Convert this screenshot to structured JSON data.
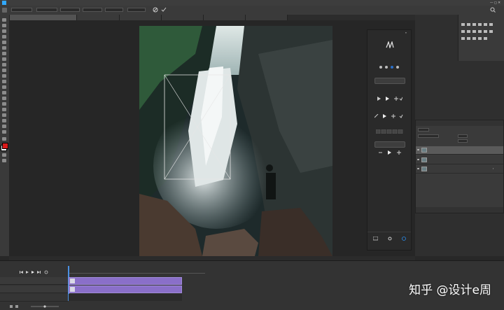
{
  "menubar": {
    "items": [
      "",
      "",
      "",
      "",
      "",
      "",
      "",
      "",
      "",
      "",
      "",
      ""
    ]
  },
  "tabs": [
    {
      "label": "",
      "active": true
    },
    {
      "label": ""
    },
    {
      "label": ""
    },
    {
      "label": ""
    },
    {
      "label": ""
    },
    {
      "label": ""
    }
  ],
  "right_top": {
    "tab1": "",
    "tab2": ""
  },
  "extension": {
    "panel_title": "",
    "logo_text": "",
    "sub_text": "",
    "btn_primary": "",
    "section1": "",
    "section2": "",
    "section3": "",
    "btn_middle": "",
    "info_title": "",
    "info_lines": [
      "",
      "",
      ""
    ],
    "info_link1": "",
    "info_link2": "",
    "bottom_tabs": [
      "",
      "",
      ""
    ]
  },
  "layers_panel": {
    "tabs": [
      "",
      "",
      ""
    ],
    "layers": [
      {
        "name": "",
        "selected": true
      },
      {
        "name": "",
        "selected": false
      },
      {
        "name": "",
        "selected": false
      }
    ]
  },
  "status_bar": {
    "zoom": "",
    "doc": ""
  },
  "timeline": {
    "title": "",
    "ruler_ticks": [
      "",
      "",
      "",
      "",
      "",
      "",
      "",
      "",
      ""
    ],
    "tracks": [
      {
        "name": "",
        "clip": ""
      },
      {
        "name": "",
        "clip": ""
      },
      {
        "name": "",
        "clip": ""
      }
    ]
  },
  "watermark": "知乎 @设计e周",
  "colors": {
    "accent": "#8a6fc9",
    "ui_dark": "#282828",
    "panel": "#3a3a3a",
    "selected_blue": "#2a6fc9"
  }
}
